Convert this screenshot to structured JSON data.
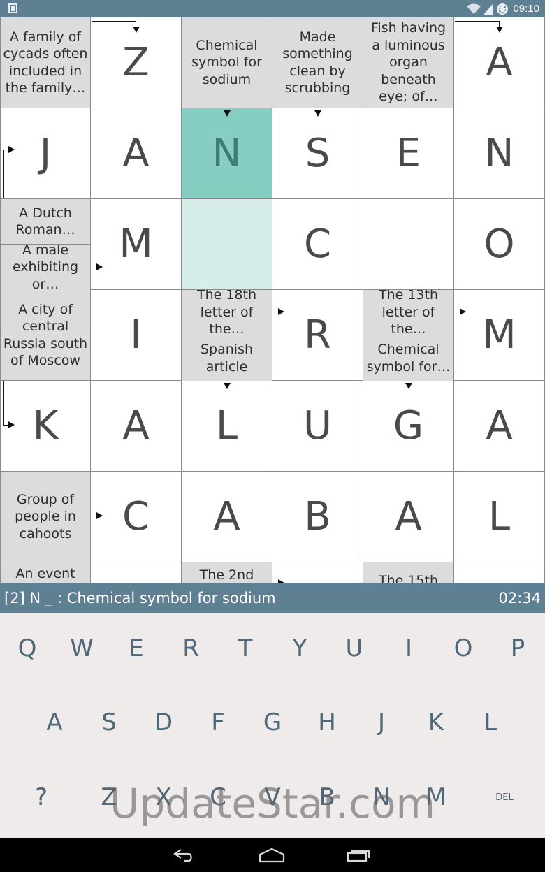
{
  "status_bar": {
    "time": "09:10",
    "icons": [
      "wifi-icon",
      "signal-icon",
      "sync-icon"
    ]
  },
  "grid": {
    "rows": [
      [
        {
          "type": "clue",
          "text": "A family of cycads often included in the family…"
        },
        {
          "type": "letter",
          "letter": "Z"
        },
        {
          "type": "clue",
          "text": "Chemical symbol for sodium"
        },
        {
          "type": "clue",
          "text": "Made something clean by scrubbing"
        },
        {
          "type": "clue",
          "text": "Fish having a luminous organ beneath eye; of…"
        },
        {
          "type": "letter",
          "letter": "A"
        }
      ],
      [
        {
          "type": "letter",
          "letter": "J"
        },
        {
          "type": "letter",
          "letter": "A"
        },
        {
          "type": "letter",
          "letter": "N",
          "state": "active"
        },
        {
          "type": "letter",
          "letter": "S"
        },
        {
          "type": "letter",
          "letter": "E"
        },
        {
          "type": "letter",
          "letter": "N"
        }
      ],
      [
        {
          "type": "split",
          "top": "A Dutch Roman…",
          "bottom": "A male exhibiting or…"
        },
        {
          "type": "letter",
          "letter": "M"
        },
        {
          "type": "letter",
          "letter": "",
          "state": "word"
        },
        {
          "type": "letter",
          "letter": "C"
        },
        {
          "type": "letter",
          "letter": ""
        },
        {
          "type": "letter",
          "letter": "O"
        }
      ],
      [
        {
          "type": "clue",
          "text": "A city of central Russia south of Moscow"
        },
        {
          "type": "letter",
          "letter": "I"
        },
        {
          "type": "split",
          "top": "The 18th letter of the…",
          "bottom": "Spanish article"
        },
        {
          "type": "letter",
          "letter": "R"
        },
        {
          "type": "split",
          "top": "The 13th letter of the…",
          "bottom": "Chemical symbol for…"
        },
        {
          "type": "letter",
          "letter": "M"
        }
      ],
      [
        {
          "type": "letter",
          "letter": "K"
        },
        {
          "type": "letter",
          "letter": "A"
        },
        {
          "type": "letter",
          "letter": "L"
        },
        {
          "type": "letter",
          "letter": "U"
        },
        {
          "type": "letter",
          "letter": "G"
        },
        {
          "type": "letter",
          "letter": "A"
        }
      ],
      [
        {
          "type": "clue",
          "text": "Group of people in cahoots"
        },
        {
          "type": "letter",
          "letter": "C"
        },
        {
          "type": "letter",
          "letter": "A"
        },
        {
          "type": "letter",
          "letter": "B"
        },
        {
          "type": "letter",
          "letter": "A"
        },
        {
          "type": "letter",
          "letter": "L"
        }
      ],
      [
        {
          "type": "clue",
          "text": "An event"
        },
        {
          "type": "letter",
          "letter": ""
        },
        {
          "type": "clue",
          "text": "The 2nd"
        },
        {
          "type": "letter",
          "letter": ""
        },
        {
          "type": "clue",
          "text": "The 15th"
        },
        {
          "type": "letter",
          "letter": ""
        }
      ]
    ]
  },
  "clue_bar": {
    "current_clue": "[2] N _ : Chemical symbol for sodium",
    "timer": "02:34"
  },
  "keyboard": {
    "rows": [
      [
        "Q",
        "W",
        "E",
        "R",
        "T",
        "Y",
        "U",
        "I",
        "O",
        "P"
      ],
      [
        "A",
        "S",
        "D",
        "F",
        "G",
        "H",
        "J",
        "K",
        "L"
      ],
      [
        "?",
        "Z",
        "X",
        "C",
        "V",
        "B",
        "N",
        "M",
        "DEL"
      ]
    ]
  },
  "watermark": "UpdateStar.com",
  "nav_bar": {
    "buttons": [
      "back-icon",
      "home-icon",
      "recents-icon"
    ]
  },
  "colors": {
    "bar": "#5f7f92",
    "active_cell": "#86cdc2",
    "word_cell": "#d7edea",
    "clue_cell": "#dcdcdc",
    "keyboard_bg": "#eeebea"
  }
}
